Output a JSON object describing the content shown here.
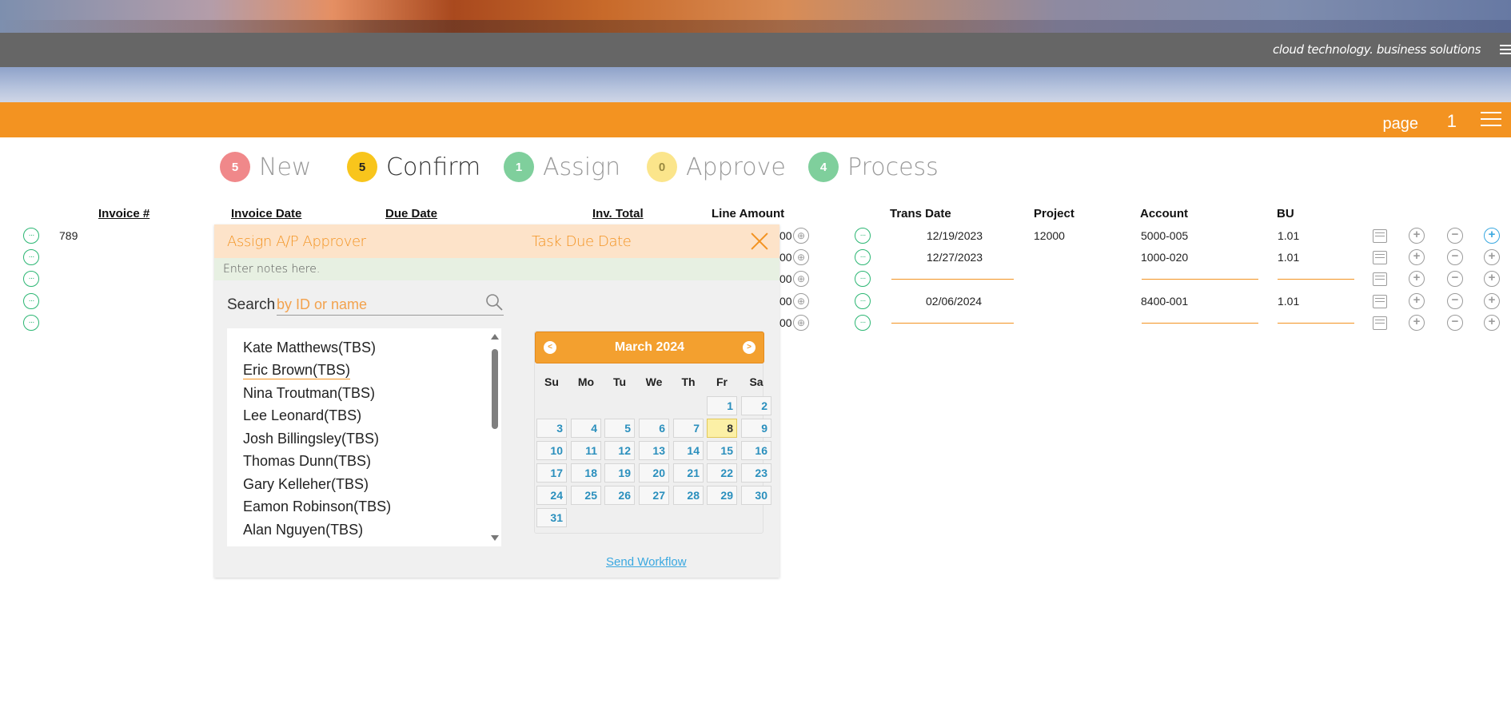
{
  "header": {
    "tagline": "cloud technology. business solutions",
    "page_label": "page",
    "page_number": "1",
    "colors": {
      "orange": "#f39321",
      "grey": "#666666",
      "green": "#2bb673"
    }
  },
  "steps": [
    {
      "count": "5",
      "label": "New",
      "color": "#f0888a"
    },
    {
      "count": "5",
      "label": "Confirm",
      "color": "#f8c51c"
    },
    {
      "count": "1",
      "label": "Assign",
      "color": "#7fcf9c"
    },
    {
      "count": "0",
      "label": "Approve",
      "color": "#fbe58b"
    },
    {
      "count": "4",
      "label": "Process",
      "color": "#7fcf9c"
    }
  ],
  "table": {
    "headers": {
      "invoice_no": "Invoice #",
      "invoice_date": "Invoice Date",
      "due_date": "Due Date",
      "inv_total": "Inv. Total",
      "line_amount": "Line Amount",
      "trans_date": "Trans Date",
      "project": "Project",
      "account": "Account",
      "bu": "BU"
    },
    "rows": [
      {
        "invoice_no": "789",
        "trans_date": "12/19/2023",
        "project": "12000",
        "account": "5000-005",
        "bu": "1.01",
        "line_amount": "00"
      },
      {
        "invoice_no": "",
        "trans_date": "12/27/2023",
        "project": "",
        "account": "1000-020",
        "bu": "1.01",
        "line_amount": "00"
      },
      {
        "invoice_no": "",
        "trans_date": "",
        "project": "",
        "account": "",
        "bu": "",
        "line_amount": "00"
      },
      {
        "invoice_no": "",
        "trans_date": "02/06/2024",
        "project": "",
        "account": "8400-001",
        "bu": "1.01",
        "line_amount": "00"
      },
      {
        "invoice_no": "",
        "trans_date": "",
        "project": "",
        "account": "",
        "bu": "",
        "line_amount": "00"
      }
    ]
  },
  "dialog": {
    "title": "Assign A/P Approver",
    "due_label": "Task Due Date",
    "notes_placeholder": "Enter notes here.",
    "search_label": "Search",
    "search_placeholder": "by ID or name",
    "names": [
      "Kate Matthews(TBS)",
      "Eric Brown(TBS)",
      "Nina Troutman(TBS)",
      "Lee Leonard(TBS)",
      "Josh Billingsley(TBS)",
      "Thomas Dunn(TBS)",
      "Gary Kelleher(TBS)",
      "Eamon Robinson(TBS)",
      "Alan Nguyen(TBS)"
    ],
    "highlighted_name": "Eric Brown(TBS)",
    "send_label": "Send Workflow"
  },
  "calendar": {
    "month_label": "March 2024",
    "prev": "<",
    "next": ">",
    "weekdays": [
      "Su",
      "Mo",
      "Tu",
      "We",
      "Th",
      "Fr",
      "Sa"
    ],
    "first_weekday_index": 5,
    "days_in_month": 31,
    "selected_day": 8
  }
}
